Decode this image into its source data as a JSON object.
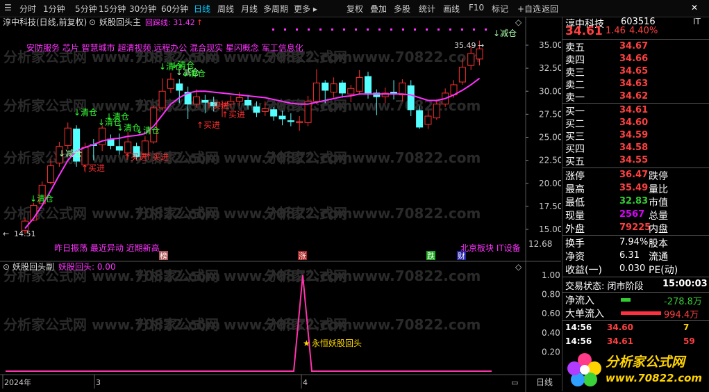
{
  "toolbar": {
    "left": [
      "分时",
      "1分钟",
      "5分钟",
      "15分钟",
      "30分钟",
      "60分钟",
      "日线",
      "周线",
      "月线",
      "多周期",
      "更多"
    ],
    "active": "日线",
    "right": [
      "复权",
      "叠加",
      "多股",
      "统计",
      "画线",
      "F10",
      "标记",
      "+自选",
      "返回"
    ]
  },
  "main": {
    "stock_title": "淳中科技(日线,前复权)",
    "indicator": "妖股回头主",
    "indicator_line": "回踩线: 31.42",
    "concepts": "安防服务 芯片 智慧城市 超清视频 远程办公 混合现实 星闪概念 军工信息化",
    "bottom_tags": "昨日振荡 最近异动 近期新高",
    "sector_tag": "北京板块 IT设备",
    "high_label": "35.49",
    "low_label": "14.51",
    "event_labels": [
      "榜",
      "涨",
      "跌",
      "财"
    ],
    "signal_labels": {
      "sell": "↓清仓",
      "reduce": "↓减仓",
      "buy": "↑买进"
    },
    "y_axis": [
      "35.00",
      "32.50",
      "30.00",
      "27.50",
      "25.00",
      "22.50",
      "20.00",
      "17.50",
      "15.00"
    ],
    "y_axis_value": [
      35,
      32.5,
      30,
      27.5,
      25,
      22.5,
      20,
      17.5,
      15
    ],
    "cursor_price": "12.68"
  },
  "sub": {
    "title": "妖股回头副",
    "line": "妖股回头: 0.00",
    "signal_text": "永恒妖股回头",
    "y_axis": [
      "1.00",
      "0.80",
      "0.60",
      "0.40",
      "0.20"
    ],
    "y_axis_value": [
      1.0,
      0.8,
      0.6,
      0.4,
      0.2
    ],
    "peak_value": 1.0
  },
  "xaxis": {
    "labels": [
      "2024年",
      "3",
      "4"
    ],
    "period": "日线"
  },
  "watermark": "分析家公式网 www.70822.com",
  "candles": [
    {
      "o": 14.9,
      "c": 15.9,
      "h": 16.3,
      "l": 14.5
    },
    {
      "o": 16.0,
      "c": 17.6,
      "h": 17.9,
      "l": 15.9
    },
    {
      "o": 17.8,
      "c": 19.8,
      "h": 20.2,
      "l": 17.7
    },
    {
      "o": 20.1,
      "c": 21.9,
      "h": 22.6,
      "l": 19.9
    },
    {
      "o": 22.2,
      "c": 24.0,
      "h": 24.5,
      "l": 21.8
    },
    {
      "o": 24.1,
      "c": 26.0,
      "h": 26.6,
      "l": 23.7
    },
    {
      "o": 25.9,
      "c": 22.4,
      "h": 26.3,
      "l": 21.8
    },
    {
      "o": 22.0,
      "c": 23.9,
      "h": 24.4,
      "l": 21.2
    },
    {
      "o": 24.2,
      "c": 24.1,
      "h": 24.8,
      "l": 22.5
    },
    {
      "o": 24.2,
      "c": 26.0,
      "h": 26.3,
      "l": 23.5
    },
    {
      "o": 24.8,
      "c": 24.1,
      "h": 25.3,
      "l": 23.7
    },
    {
      "o": 24.0,
      "c": 23.6,
      "h": 25.4,
      "l": 23.1
    },
    {
      "o": 23.3,
      "c": 24.5,
      "h": 25.6,
      "l": 22.9
    },
    {
      "o": 24.0,
      "c": 22.9,
      "h": 24.4,
      "l": 22.5
    },
    {
      "o": 23.2,
      "c": 24.6,
      "h": 25.1,
      "l": 22.6
    },
    {
      "o": 24.5,
      "c": 28.2,
      "h": 28.4,
      "l": 24.3
    },
    {
      "o": 28.2,
      "c": 30.0,
      "h": 31.4,
      "l": 27.9
    },
    {
      "o": 30.3,
      "c": 31.3,
      "h": 32.0,
      "l": 29.8
    },
    {
      "o": 30.8,
      "c": 30.1,
      "h": 31.3,
      "l": 28.7
    },
    {
      "o": 29.9,
      "c": 28.6,
      "h": 30.5,
      "l": 27.0
    },
    {
      "o": 28.6,
      "c": 29.4,
      "h": 30.2,
      "l": 28.2
    },
    {
      "o": 29.0,
      "c": 28.8,
      "h": 29.6,
      "l": 27.6
    },
    {
      "o": 28.8,
      "c": 28.4,
      "h": 29.4,
      "l": 27.8
    },
    {
      "o": 28.4,
      "c": 28.6,
      "h": 29.0,
      "l": 27.2
    },
    {
      "o": 28.6,
      "c": 28.9,
      "h": 29.5,
      "l": 28.1
    },
    {
      "o": 28.9,
      "c": 29.3,
      "h": 29.9,
      "l": 28.4
    },
    {
      "o": 29.0,
      "c": 28.5,
      "h": 29.6,
      "l": 28.0
    },
    {
      "o": 28.3,
      "c": 27.7,
      "h": 28.9,
      "l": 27.2
    },
    {
      "o": 27.8,
      "c": 28.1,
      "h": 28.9,
      "l": 27.3
    },
    {
      "o": 28.0,
      "c": 27.3,
      "h": 28.3,
      "l": 26.8
    },
    {
      "o": 27.3,
      "c": 27.0,
      "h": 27.9,
      "l": 26.3
    },
    {
      "o": 26.8,
      "c": 26.7,
      "h": 27.6,
      "l": 26.2
    },
    {
      "o": 26.6,
      "c": 26.7,
      "h": 27.3,
      "l": 25.7
    },
    {
      "o": 26.6,
      "c": 28.9,
      "h": 29.5,
      "l": 26.2
    },
    {
      "o": 28.9,
      "c": 30.9,
      "h": 32.4,
      "l": 28.6
    },
    {
      "o": 30.9,
      "c": 30.1,
      "h": 31.2,
      "l": 28.7
    },
    {
      "o": 29.9,
      "c": 30.8,
      "h": 31.5,
      "l": 29.3
    },
    {
      "o": 30.9,
      "c": 29.8,
      "h": 31.2,
      "l": 29.3
    },
    {
      "o": 29.7,
      "c": 30.3,
      "h": 30.7,
      "l": 28.8
    },
    {
      "o": 30.0,
      "c": 31.5,
      "h": 32.3,
      "l": 29.6
    },
    {
      "o": 31.6,
      "c": 29.8,
      "h": 32.1,
      "l": 29.2
    },
    {
      "o": 29.8,
      "c": 29.4,
      "h": 30.2,
      "l": 27.4
    },
    {
      "o": 29.4,
      "c": 29.8,
      "h": 30.4,
      "l": 28.7
    },
    {
      "o": 29.9,
      "c": 29.7,
      "h": 31.2,
      "l": 29.1
    },
    {
      "o": 29.6,
      "c": 30.9,
      "h": 31.3,
      "l": 28.9
    },
    {
      "o": 30.6,
      "c": 28.0,
      "h": 31.2,
      "l": 27.3
    },
    {
      "o": 27.9,
      "c": 26.1,
      "h": 28.4,
      "l": 25.9
    },
    {
      "o": 26.4,
      "c": 27.3,
      "h": 27.9,
      "l": 25.9
    },
    {
      "o": 27.1,
      "c": 28.6,
      "h": 29.1,
      "l": 26.9
    },
    {
      "o": 28.6,
      "c": 29.8,
      "h": 30.3,
      "l": 28.3
    },
    {
      "o": 29.6,
      "c": 30.7,
      "h": 31.2,
      "l": 29.3
    },
    {
      "o": 31.0,
      "c": 32.6,
      "h": 33.6,
      "l": 30.7
    },
    {
      "o": 32.8,
      "c": 34.1,
      "h": 34.9,
      "l": 32.3
    },
    {
      "o": 33.5,
      "c": 34.6,
      "h": 35.49,
      "l": 32.8
    }
  ],
  "ma": [
    15.1,
    16.2,
    17.6,
    19.2,
    20.9,
    22.5,
    23.5,
    23.9,
    24.2,
    24.6,
    24.8,
    24.9,
    25.1,
    25.2,
    25.4,
    26.2,
    27.4,
    28.6,
    29.3,
    29.8,
    30.0,
    30.0,
    29.9,
    29.8,
    29.7,
    29.6,
    29.5,
    29.4,
    29.3,
    29.1,
    28.9,
    28.7,
    28.6,
    28.6,
    28.8,
    29.0,
    29.2,
    29.4,
    29.5,
    29.7,
    29.7,
    29.7,
    29.7,
    29.7,
    29.7,
    29.6,
    29.3,
    29.0,
    29.0,
    29.2,
    29.6,
    30.1,
    30.7,
    31.4
  ],
  "quote": {
    "name": "淳中科技",
    "code": "603516",
    "price": "34.61",
    "change": "1.46",
    "pct": "4.40%",
    "sell": [
      [
        "卖五",
        "34.67"
      ],
      [
        "卖四",
        "34.66"
      ],
      [
        "卖三",
        "34.65"
      ],
      [
        "卖二",
        "34.63"
      ],
      [
        "卖一",
        "34.62"
      ]
    ],
    "buy": [
      [
        "买一",
        "34.61"
      ],
      [
        "买二",
        "34.60"
      ],
      [
        "买三",
        "34.59"
      ],
      [
        "买四",
        "34.58"
      ],
      [
        "买五",
        "34.55"
      ]
    ],
    "stats": [
      [
        "涨停",
        "36.47",
        "跌停",
        "#fff"
      ],
      [
        "最高",
        "35.49",
        "量比",
        "#fff"
      ],
      [
        "最低",
        "32.83",
        "市值",
        "#fff"
      ],
      [
        "现量",
        "2567",
        "总量",
        "#d0f"
      ],
      [
        "外盘",
        "79225",
        "内盘",
        "#ff4040"
      ]
    ],
    "stats_color": [
      "#ff4040",
      "#ff4040",
      "#3c3",
      "#d0f",
      "#ff4040"
    ],
    "stats2": [
      [
        "换手",
        "7.94%",
        "股本"
      ],
      [
        "净资",
        "6.31",
        "流通"
      ],
      [
        "收益(一)",
        "0.030",
        "PE(动)"
      ]
    ],
    "status_label": "交易状态: 闭市阶段",
    "status_time": "15:00:03",
    "flow": [
      [
        "净流入",
        "-278.8万"
      ],
      [
        "大单流入",
        "994.4万"
      ]
    ],
    "ticks": [
      [
        "14:56",
        "34.60",
        "7",
        "S"
      ],
      [
        "14:56",
        "34.61",
        "59",
        "B"
      ]
    ],
    "logo_text": "分析家公式网",
    "logo_url": "www.70822.com",
    "corner": "IT"
  }
}
